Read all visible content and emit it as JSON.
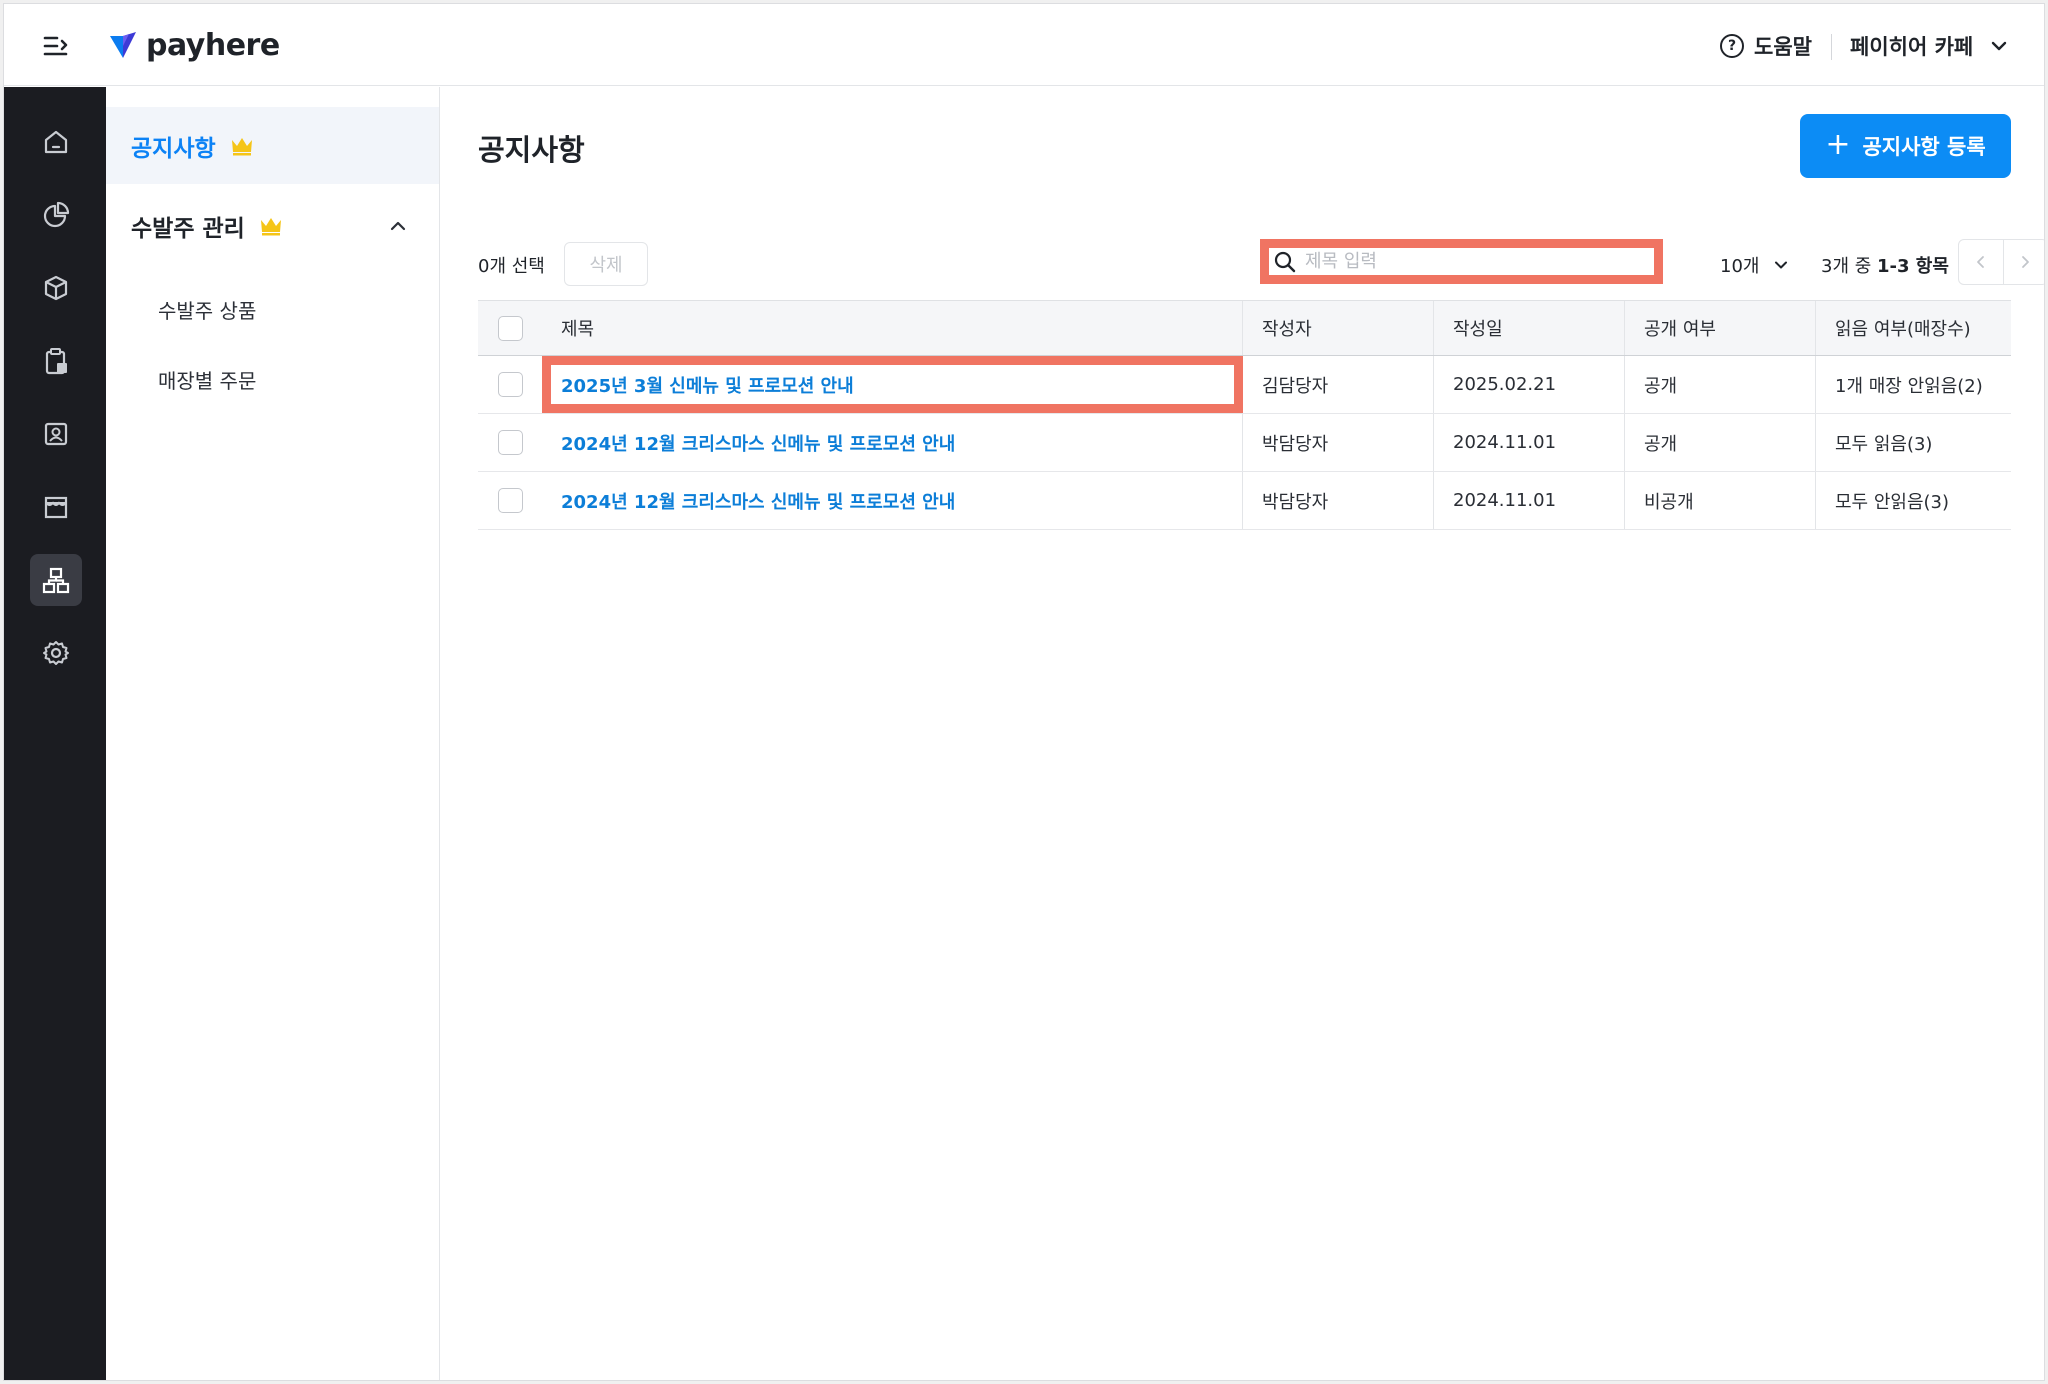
{
  "brand": {
    "name": "payhere",
    "accent": "#0c8cf5"
  },
  "topbar": {
    "help_label": "도움말",
    "store_name": "페이히어 카페"
  },
  "rail": {
    "items": [
      {
        "icon": "home-icon"
      },
      {
        "icon": "pie-chart-icon"
      },
      {
        "icon": "box-icon"
      },
      {
        "icon": "clipboard-icon"
      },
      {
        "icon": "user-card-icon"
      },
      {
        "icon": "store-icon"
      },
      {
        "icon": "org-chart-icon",
        "active": true
      },
      {
        "icon": "gear-icon"
      }
    ]
  },
  "subnav": {
    "active_label": "공지사항",
    "group_label": "수발주 관리",
    "sub_items": [
      "수발주 상품",
      "매장별 주문"
    ]
  },
  "main": {
    "title": "공지사항",
    "register_label": "공지사항 등록",
    "selected_count": "0개 선택",
    "delete_label": "삭제",
    "search_placeholder": "제목 입력",
    "page_size": "10개",
    "range_prefix": "3개 중 ",
    "range_bold": "1-3 항목"
  },
  "table": {
    "columns": [
      "제목",
      "작성자",
      "작성일",
      "공개 여부",
      "읽음 여부(매장수)"
    ],
    "rows": [
      {
        "title": "2025년 3월 신메뉴 및 프로모션 안내",
        "author": "김담당자",
        "date": "2025.02.21",
        "public": "공개",
        "read": "1개 매장 안읽음(2)"
      },
      {
        "title": "2024년 12월 크리스마스 신메뉴 및 프로모션 안내",
        "author": "박담당자",
        "date": "2024.11.01",
        "public": "공개",
        "read": "모두 읽음(3)"
      },
      {
        "title": "2024년 12월 크리스마스 신메뉴 및 프로모션 안내",
        "author": "박담당자",
        "date": "2024.11.01",
        "public": "비공개",
        "read": "모두 안읽음(3)"
      }
    ]
  }
}
